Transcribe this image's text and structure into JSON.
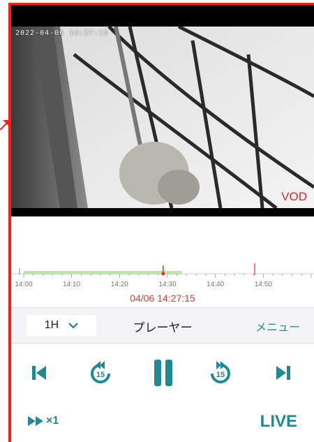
{
  "video": {
    "timestamp_overlay": "2022-04-06 14:27:15",
    "mode_label": "VOD"
  },
  "timeline": {
    "tick_labels": [
      "14:00",
      "14:10",
      "14:20",
      "14:30",
      "14:40",
      "14:50"
    ],
    "current_time": "04/06 14:27:15",
    "recorded_fraction": 0.55,
    "playhead_fraction": 0.485,
    "recorded_color": "#bfe3b0",
    "marker_color": "#e03030"
  },
  "toolbar": {
    "range_value": "1H",
    "title": "プレーヤー",
    "menu_label": "メニュー"
  },
  "controls": {
    "skip_seconds": "15",
    "speed_label": "×1",
    "live_label": "LIVE",
    "accent_color": "#1f8a8f",
    "icons": [
      "skip-to-start-icon",
      "rewind-15-icon",
      "pause-icon",
      "forward-15-icon",
      "skip-to-end-icon",
      "fast-forward-icon"
    ]
  }
}
